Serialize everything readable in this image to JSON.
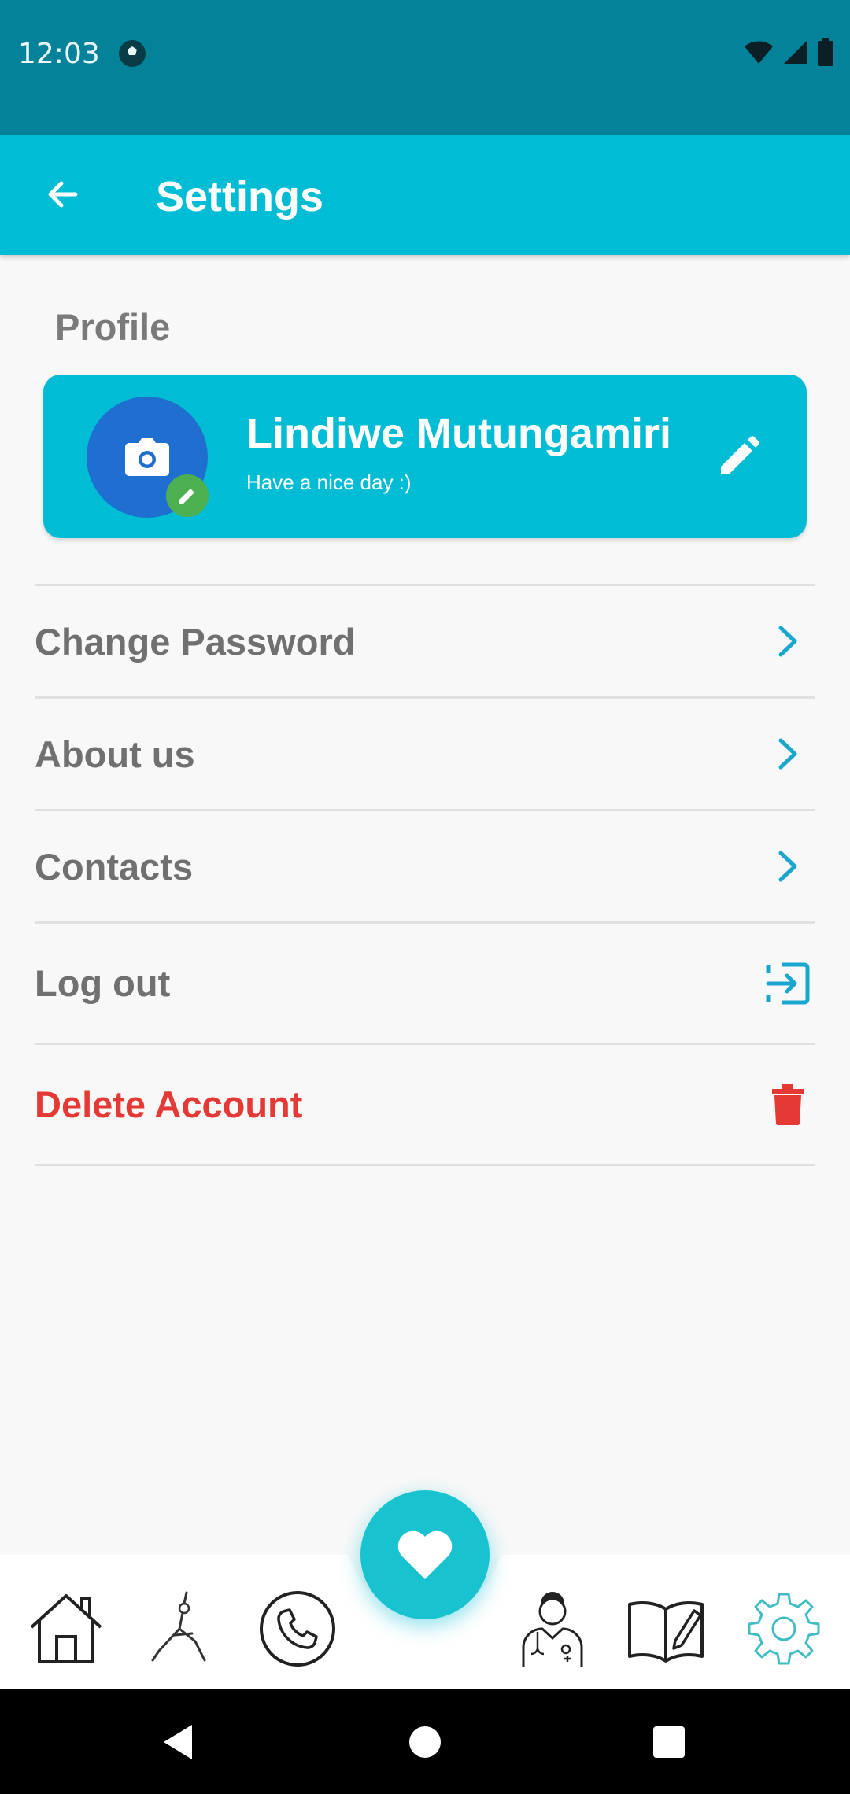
{
  "status_bar": {
    "time": "12:03"
  },
  "app_bar": {
    "title": "Settings"
  },
  "profile": {
    "section_label": "Profile",
    "name": "Lindiwe Mutungamiri",
    "greeting": "Have a nice day :)"
  },
  "menu": {
    "items": [
      {
        "label": "Change Password",
        "icon": "chevron-right-icon"
      },
      {
        "label": "About us",
        "icon": "chevron-right-icon"
      },
      {
        "label": "Contacts",
        "icon": "chevron-right-icon"
      },
      {
        "label": "Log out",
        "icon": "logout-icon"
      },
      {
        "label": "Delete Account",
        "icon": "trash-icon"
      }
    ]
  },
  "bottom_nav": {
    "items": [
      "home-icon",
      "yoga-icon",
      "phone-icon",
      "heart-icon",
      "doctor-icon",
      "journal-icon",
      "settings-gear-icon"
    ],
    "active": "settings-gear-icon"
  },
  "colors": {
    "primary": "#00bcd4",
    "status_bar": "#038299",
    "avatar": "#1e6fd0",
    "avatar_edit": "#4caf50",
    "danger": "#e53935",
    "text_muted": "#707070"
  }
}
